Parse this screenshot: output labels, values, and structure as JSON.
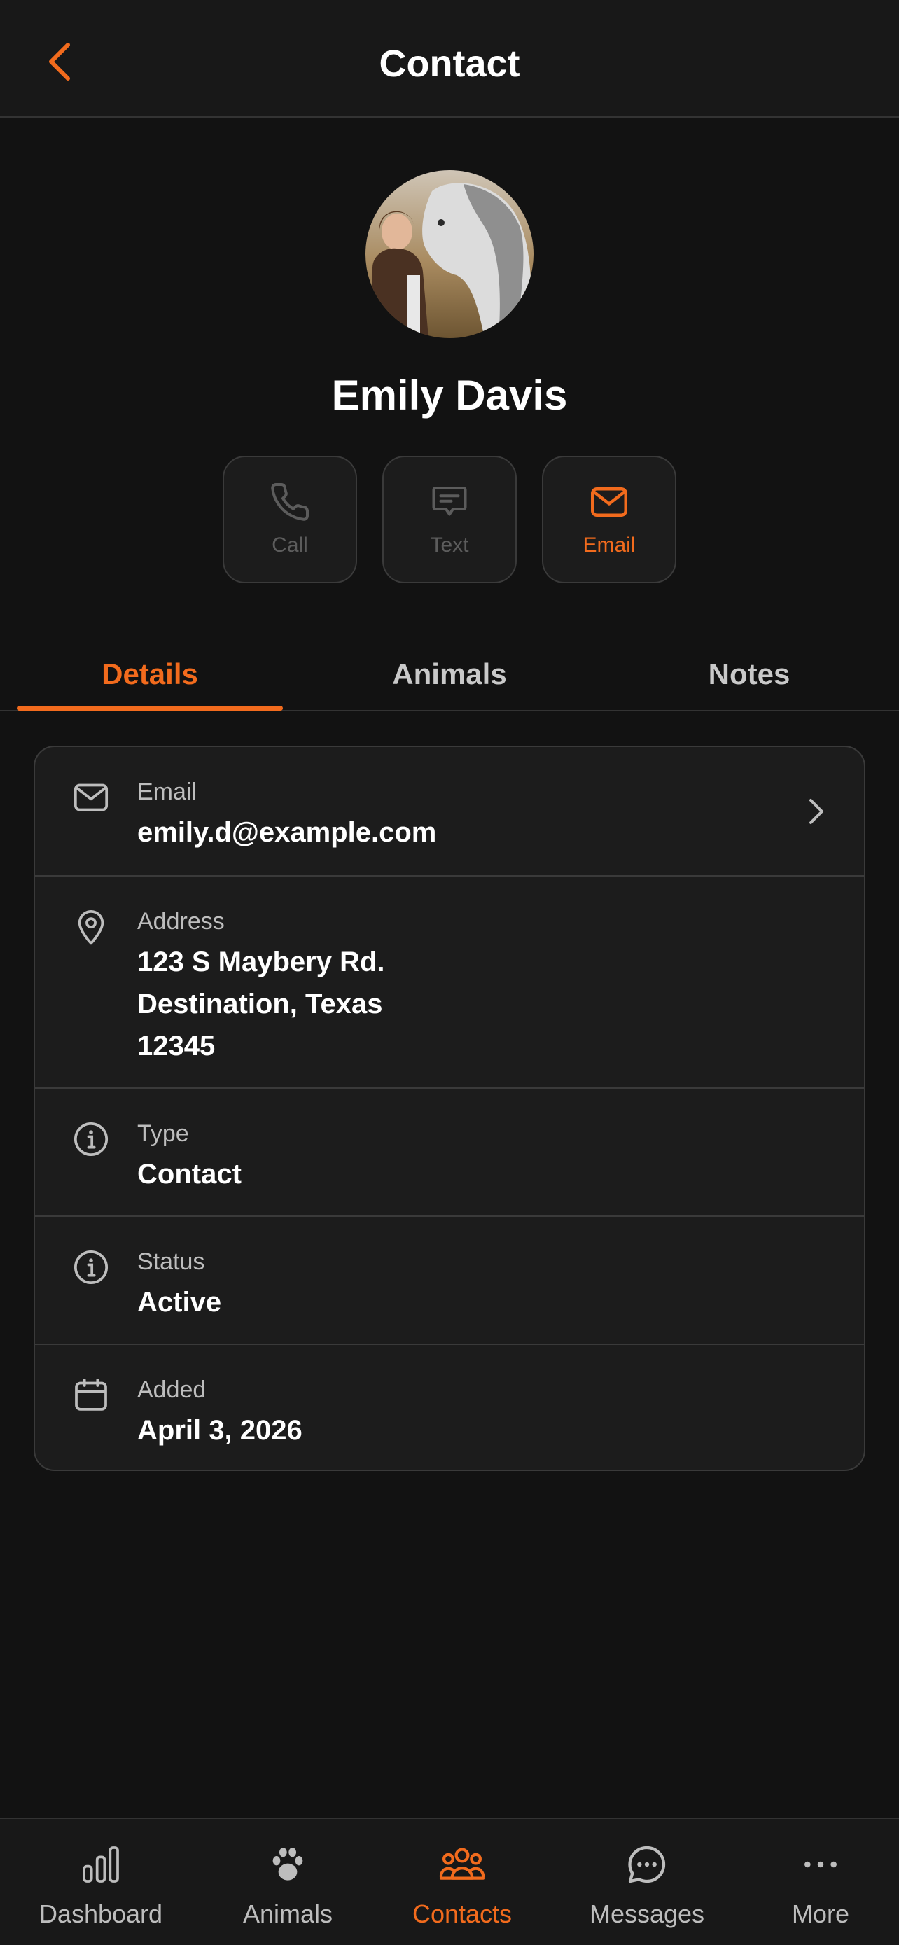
{
  "header": {
    "title": "Contact",
    "back_icon": "chevron-left-icon"
  },
  "profile": {
    "name": "Emily Davis",
    "avatar_icon": "avatar-photo"
  },
  "actions": [
    {
      "label": "Call",
      "icon": "phone-icon",
      "state": "disabled"
    },
    {
      "label": "Text",
      "icon": "message-icon",
      "state": "disabled"
    },
    {
      "label": "Email",
      "icon": "mail-icon",
      "state": "active"
    }
  ],
  "tabs": [
    {
      "label": "Details",
      "active": true
    },
    {
      "label": "Animals",
      "active": false
    },
    {
      "label": "Notes",
      "active": false
    }
  ],
  "details": {
    "email": {
      "label": "Email",
      "value": "emily.d@example.com",
      "icon": "mail-icon"
    },
    "address": {
      "label": "Address",
      "line1": "123 S Maybery Rd.",
      "line2": "Destination, Texas",
      "line3": "12345",
      "icon": "map-pin-icon"
    },
    "type": {
      "label": "Type",
      "value": "Contact",
      "icon": "info-icon"
    },
    "status": {
      "label": "Status",
      "value": "Active",
      "icon": "info-icon"
    },
    "added": {
      "label": "Added",
      "value": "April 3, 2026",
      "icon": "calendar-icon"
    }
  },
  "bottom_nav": [
    {
      "label": "Dashboard",
      "icon": "bar-chart-icon",
      "active": false
    },
    {
      "label": "Animals",
      "icon": "paw-icon",
      "active": false
    },
    {
      "label": "Contacts",
      "icon": "users-icon",
      "active": true
    },
    {
      "label": "Messages",
      "icon": "chat-bubble-icon",
      "active": false
    },
    {
      "label": "More",
      "icon": "more-horizontal-icon",
      "active": false
    }
  ],
  "colors": {
    "accent": "#f26b1d",
    "background": "#121212",
    "surface": "#1c1c1c",
    "border": "#3a3a3a",
    "muted_text": "#bdbdbd"
  }
}
